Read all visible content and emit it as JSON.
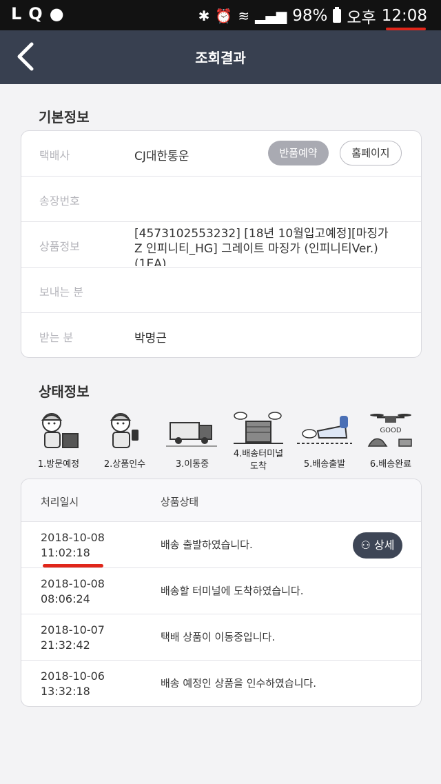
{
  "status_bar": {
    "left_icons": [
      "L",
      "Q",
      "app-icon"
    ],
    "battery": "98%",
    "ampm": "오후",
    "time": "12:08"
  },
  "header": {
    "title": "조회결과"
  },
  "basic_info": {
    "section_title": "기본정보",
    "rows": [
      {
        "label": "택배사",
        "value": "CJ대한통운"
      },
      {
        "label": "송장번호",
        "value": ""
      },
      {
        "label": "상품정보",
        "value": "[4573102553232] [18년 10월입고예정][마징가Z 인피니티_HG] 그레이트 마징가 (인피니티Ver.)(1EA)"
      },
      {
        "label": "보내는 분",
        "value": ""
      },
      {
        "label": "받는 분",
        "value": "박명근"
      }
    ],
    "return_button": "반품예약",
    "homepage_button": "홈페이지"
  },
  "status_info": {
    "section_title": "상태정보",
    "steps": [
      {
        "label": "1.방문예정",
        "icon": "courier-box-icon"
      },
      {
        "label": "2.상품인수",
        "icon": "courier-phone-icon"
      },
      {
        "label": "3.이동중",
        "icon": "truck-icon"
      },
      {
        "label": "4.배송터미널\n도착",
        "icon": "terminal-building-icon"
      },
      {
        "label": "5.배송출발",
        "icon": "delivery-departure-icon"
      },
      {
        "label": "6.배송완료",
        "icon": "drone-good-icon"
      }
    ],
    "table": {
      "col_time": "처리일시",
      "col_status": "상품상태",
      "rows": [
        {
          "date": "2018-10-08",
          "time": "11:02:18",
          "status": "배송 출발하였습니다.",
          "detail": "상세"
        },
        {
          "date": "2018-10-08",
          "time": "08:06:24",
          "status": "배송할 터미널에 도착하였습니다."
        },
        {
          "date": "2018-10-07",
          "time": "21:32:42",
          "status": "택배 상품이 이동중입니다."
        },
        {
          "date": "2018-10-06",
          "time": "13:32:18",
          "status": "배송 예정인 상품을 인수하였습니다."
        }
      ]
    }
  },
  "colors": {
    "header": "#384050",
    "accent_underline": "#e0261a",
    "status_bar": "#121212"
  }
}
